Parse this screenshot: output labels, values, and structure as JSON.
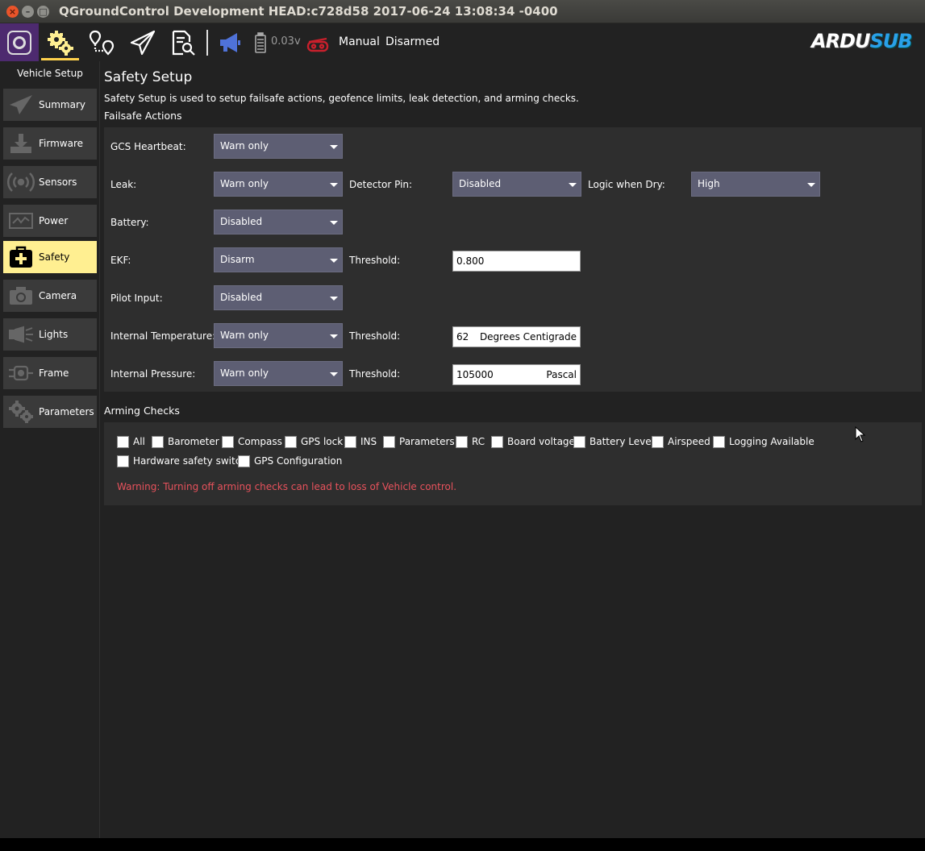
{
  "window": {
    "title": "QGroundControl Development HEAD:c728d58 2017-06-24 13:08:34 -0400"
  },
  "toolbar": {
    "battery_value": "0.03v",
    "flight_mode": "Manual",
    "arm_state": "Disarmed",
    "brand_part1": "ARDU",
    "brand_part2": "SUB",
    "brand_colors": {
      "primary": "#ffffff",
      "accent": "#2aa0e8"
    },
    "active_tab_color": "#ffd24d"
  },
  "sidebar": {
    "title": "Vehicle Setup",
    "items": [
      {
        "label": "Summary",
        "icon": "paper-plane-icon"
      },
      {
        "label": "Firmware",
        "icon": "download-icon"
      },
      {
        "label": "Sensors",
        "icon": "radio-waves-icon"
      },
      {
        "label": "Power",
        "icon": "power-graph-icon"
      },
      {
        "label": "Safety",
        "icon": "medkit-icon",
        "active": true
      },
      {
        "label": "Camera",
        "icon": "camera-icon"
      },
      {
        "label": "Lights",
        "icon": "flashlight-icon"
      },
      {
        "label": "Frame",
        "icon": "frame-icon"
      },
      {
        "label": "Parameters",
        "icon": "gears-icon"
      }
    ]
  },
  "page": {
    "title": "Safety Setup",
    "description": "Safety Setup is used to setup failsafe actions, geofence limits, leak detection, and arming checks.",
    "failsafe_heading": "Failsafe Actions",
    "arming_heading": "Arming Checks",
    "arming_warning": "Warning: Turning off arming checks can lead to loss of Vehicle control."
  },
  "failsafe": {
    "gcs_heartbeat": {
      "label": "GCS Heartbeat:",
      "value": "Warn only"
    },
    "leak": {
      "label": "Leak:",
      "value": "Warn only"
    },
    "detector_pin": {
      "label": "Detector Pin:",
      "value": "Disabled"
    },
    "logic_when_dry": {
      "label": "Logic when Dry:",
      "value": "High"
    },
    "battery": {
      "label": "Battery:",
      "value": "Disabled"
    },
    "ekf": {
      "label": "EKF:",
      "value": "Disarm"
    },
    "ekf_threshold": {
      "label": "Threshold:",
      "value": "0.800"
    },
    "pilot_input": {
      "label": "Pilot Input:",
      "value": "Disabled"
    },
    "internal_temperature": {
      "label": "Internal Temperature:",
      "value": "Warn only"
    },
    "temp_threshold": {
      "label": "Threshold:",
      "value": "62",
      "unit": "Degrees Centigrade"
    },
    "internal_pressure": {
      "label": "Internal Pressure:",
      "value": "Warn only"
    },
    "pressure_threshold": {
      "label": "Threshold:",
      "value": "105000",
      "unit": "Pascal"
    }
  },
  "arming_checks": [
    {
      "label": "All",
      "checked": false
    },
    {
      "label": "Barometer",
      "checked": false
    },
    {
      "label": "Compass",
      "checked": false
    },
    {
      "label": "GPS lock",
      "checked": false
    },
    {
      "label": "INS",
      "checked": false
    },
    {
      "label": "Parameters",
      "checked": false
    },
    {
      "label": "RC",
      "checked": false
    },
    {
      "label": "Board voltage",
      "checked": false
    },
    {
      "label": "Battery Level",
      "checked": false
    },
    {
      "label": "Airspeed",
      "checked": false
    },
    {
      "label": "Logging Available",
      "checked": false
    },
    {
      "label": "Hardware safety switch",
      "checked": false
    },
    {
      "label": "GPS Configuration",
      "checked": false
    }
  ]
}
